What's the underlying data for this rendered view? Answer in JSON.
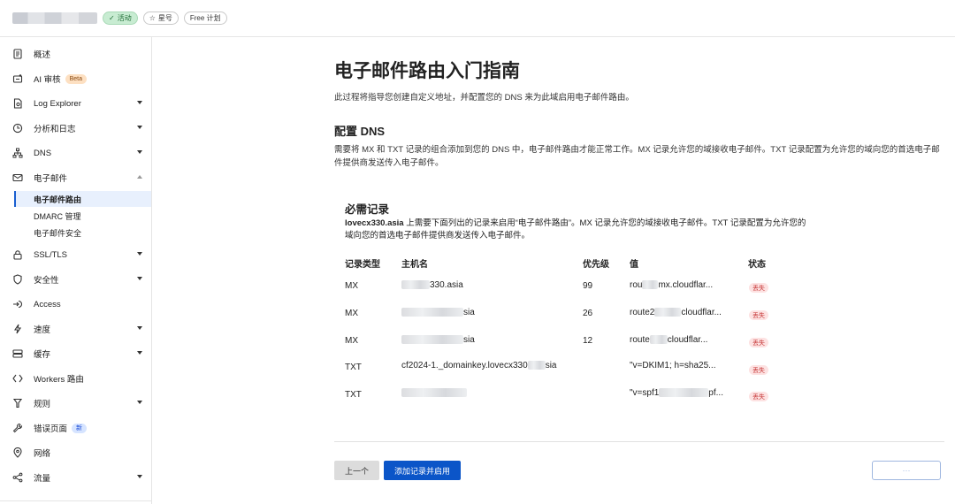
{
  "header": {
    "status_badge": "活动",
    "star_badge": "星号",
    "plan_badge": "Free 计划"
  },
  "sidebar": {
    "items": [
      {
        "label": "概述",
        "icon": "document-icon"
      },
      {
        "label": "AI 审核",
        "icon": "ai-audit-icon",
        "tag": "Beta"
      },
      {
        "label": "Log Explorer",
        "icon": "log-file-icon"
      },
      {
        "label": "分析和日志",
        "icon": "analytics-clock-icon"
      },
      {
        "label": "DNS",
        "icon": "dns-network-icon"
      },
      {
        "label": "电子邮件",
        "icon": "email-icon"
      },
      {
        "label": "SSL/TLS",
        "icon": "lock-icon"
      },
      {
        "label": "安全性",
        "icon": "shield-icon"
      },
      {
        "label": "Access",
        "icon": "access-arrow-icon"
      },
      {
        "label": "速度",
        "icon": "lightning-icon"
      },
      {
        "label": "缓存",
        "icon": "cache-server-icon"
      },
      {
        "label": "Workers 路由",
        "icon": "workers-icon"
      },
      {
        "label": "规则",
        "icon": "rules-icon"
      },
      {
        "label": "错误页面",
        "icon": "wrench-icon",
        "tag": "新"
      },
      {
        "label": "网络",
        "icon": "location-pin-icon"
      },
      {
        "label": "流量",
        "icon": "traffic-icon"
      }
    ],
    "email_sub": [
      "电子邮件路由",
      "DMARC 管理",
      "电子邮件安全"
    ]
  },
  "main": {
    "title": "电子邮件路由入门指南",
    "description": "此过程将指导您创建自定义地址，并配置您的 DNS 来为此域启用电子邮件路由。",
    "section_title": "配置 DNS",
    "section_desc": "需要将 MX 和 TXT 记录的组合添加到您的 DNS 中，电子邮件路由才能正常工作。MX 记录允许您的域接收电子邮件。TXT 记录配置为允许您的域向您的首选电子邮件提供商发送传入电子邮件。",
    "records_title": "必需记录",
    "records_domain": "lovecx330.asia",
    "records_desc": " 上需要下面列出的记录来启用“电子邮件路由”。MX 记录允许您的域接收电子邮件。TXT 记录配置为允许您的域向您的首选电子邮件提供商发送传入电子邮件。",
    "table": {
      "headers": [
        "记录类型",
        "主机名",
        "优先级",
        "值",
        "状态"
      ],
      "rows": [
        {
          "type": "MX",
          "host": "330.asia",
          "priority": "99",
          "value_a": "rou",
          "value_b": "mx.cloudflar...",
          "status": "丢失"
        },
        {
          "type": "MX",
          "host": "sia",
          "priority": "26",
          "value_a": "route2",
          "value_b": "cloudflar...",
          "status": "丢失"
        },
        {
          "type": "MX",
          "host": "sia",
          "priority": "12",
          "value_a": "route",
          "value_b": "cloudflar...",
          "status": "丢失"
        },
        {
          "type": "TXT",
          "host": "cf2024-1._domainkey.lovecx330",
          "host_tail": "sia",
          "priority": "",
          "value_a": "\"v=DKIM1; h=sha25...",
          "value_b": "",
          "status": "丢失"
        },
        {
          "type": "TXT",
          "host": "",
          "priority": "",
          "value_a": "\"v=spf1",
          "value_b": "",
          "value_tail": "pf...",
          "status": "丢失"
        }
      ]
    },
    "btn_prev": "上一个",
    "btn_add": "添加记录并启用",
    "btn_more": "···"
  }
}
